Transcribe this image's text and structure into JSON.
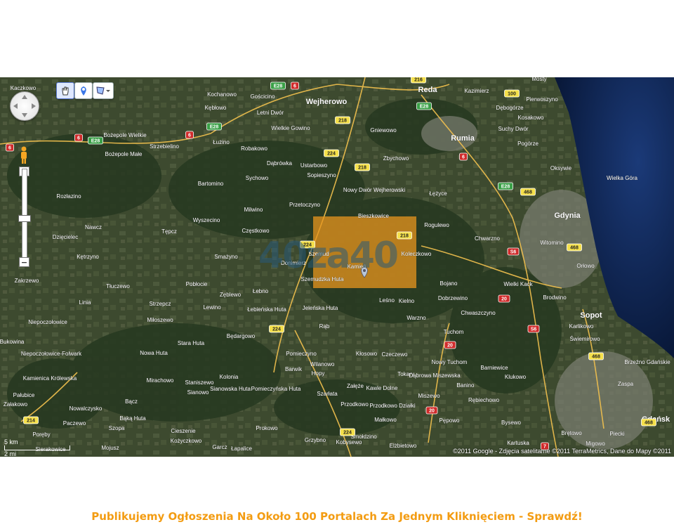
{
  "map": {
    "colors": {
      "forest": "#2e3f24",
      "fields": "#4a5a3a",
      "sea": "#0d1f45",
      "highlight": "#e8951e",
      "road": "#f2c14e"
    },
    "controls": {
      "pan_icon": "pan-circle-icon",
      "hand_tool": "hand-icon",
      "marker_tool": "marker-icon",
      "shape_tool": "polygon-icon",
      "zoom_in": "+",
      "zoom_out": "−"
    },
    "scale": {
      "km": "5 km",
      "mi": "2 mi"
    },
    "copyright": "©2011 Google - Zdjęcia satelitarne ©2011 TerraMetrics, Dane do Mapy ©2011",
    "watermark": "40za40",
    "selected_place": "Kamień",
    "places": [
      {
        "id": "kaczkowo",
        "name": "Kaczkowo"
      },
      {
        "id": "kochanowo",
        "name": "Kochanowo"
      },
      {
        "id": "goscicino",
        "name": "Gościcino"
      },
      {
        "id": "wejherowo",
        "name": "Wejherowo"
      },
      {
        "id": "reda",
        "name": "Reda"
      },
      {
        "id": "kazimierz",
        "name": "Kazimierz"
      },
      {
        "id": "mosty",
        "name": "Mosty"
      },
      {
        "id": "pierwoszyno",
        "name": "Pierwoszyno"
      },
      {
        "id": "kebiowo",
        "name": "Kębłowo"
      },
      {
        "id": "letnidwor",
        "name": "Letni Dwór"
      },
      {
        "id": "wielkiegowino",
        "name": "Wielkie Gowino"
      },
      {
        "id": "gniewowo",
        "name": "Gniewowo"
      },
      {
        "id": "rumia",
        "name": "Rumia"
      },
      {
        "id": "debogorze",
        "name": "Dębogórze"
      },
      {
        "id": "kosakowo",
        "name": "Kosakowo"
      },
      {
        "id": "suchydwor",
        "name": "Suchy Dwór"
      },
      {
        "id": "bozepolewielkie",
        "name": "Bożepole Wielkie"
      },
      {
        "id": "bozepolemale",
        "name": "Bożepole Małe"
      },
      {
        "id": "strzebielino",
        "name": "Strzebielino"
      },
      {
        "id": "luzino",
        "name": "Łużino"
      },
      {
        "id": "robakowo",
        "name": "Robakowo"
      },
      {
        "id": "zbychowo",
        "name": "Zbychowo"
      },
      {
        "id": "pogorze",
        "name": "Pogórze"
      },
      {
        "id": "oksywie",
        "name": "Oksywie"
      },
      {
        "id": "dabrowka",
        "name": "Dąbrówka"
      },
      {
        "id": "ustarbowo",
        "name": "Ustarbowo"
      },
      {
        "id": "bartomino",
        "name": "Bartomino"
      },
      {
        "id": "sychowo",
        "name": "Sychowo"
      },
      {
        "id": "sopieszyno",
        "name": "Sopieszyno"
      },
      {
        "id": "nowydwor",
        "name": "Nowy Dwór Wejherowski"
      },
      {
        "id": "lezyce",
        "name": "Łężyce"
      },
      {
        "id": "rozlazino",
        "name": "Rozłazino"
      },
      {
        "id": "przetoczyno",
        "name": "Przetoczyno"
      },
      {
        "id": "milwino",
        "name": "Milwino"
      },
      {
        "id": "bieszkowice",
        "name": "Bieszkowice"
      },
      {
        "id": "gdynia",
        "name": "Gdynia"
      },
      {
        "id": "rogulewo",
        "name": "Rogulewo"
      },
      {
        "id": "nawcz",
        "name": "Nawcz"
      },
      {
        "id": "tepcz",
        "name": "Tępcz"
      },
      {
        "id": "wyszecino",
        "name": "Wyszecino"
      },
      {
        "id": "czestkowo",
        "name": "Częstkowo"
      },
      {
        "id": "dzieciele",
        "name": "Dzięcielec"
      },
      {
        "id": "szemud",
        "name": "Szemud"
      },
      {
        "id": "koleczkowo",
        "name": "Koleczkowo"
      },
      {
        "id": "chwarzno",
        "name": "Chwarzno"
      },
      {
        "id": "witomino",
        "name": "Witomino"
      },
      {
        "id": "ketrzyno",
        "name": "Kętrzyno"
      },
      {
        "id": "smazyno",
        "name": "Smażyno"
      },
      {
        "id": "donimierz",
        "name": "Donimierz"
      },
      {
        "id": "kamien",
        "name": "Kamień"
      },
      {
        "id": "orlowo",
        "name": "Orłowo"
      },
      {
        "id": "zakrzewo",
        "name": "Zakrzewo"
      },
      {
        "id": "pobłocie",
        "name": "Pobłocie"
      },
      {
        "id": "szemudzkahuta",
        "name": "Szemudzka Huta"
      },
      {
        "id": "bojano",
        "name": "Bojano"
      },
      {
        "id": "wielkikack",
        "name": "Wielki Kack"
      },
      {
        "id": "tluczewo",
        "name": "Tłuczewo"
      },
      {
        "id": "zeblewo",
        "name": "Zęblewo"
      },
      {
        "id": "lebno",
        "name": "Łebno"
      },
      {
        "id": "brodwino",
        "name": "Brodwino"
      },
      {
        "id": "linia",
        "name": "Linia"
      },
      {
        "id": "strzepcz",
        "name": "Strzepcz"
      },
      {
        "id": "lewino",
        "name": "Lewino"
      },
      {
        "id": "lebienskahuta",
        "name": "Łebieńska Huta"
      },
      {
        "id": "jelenskahuta",
        "name": "Jeleńska Huta"
      },
      {
        "id": "lesno",
        "name": "Leśno"
      },
      {
        "id": "kielno",
        "name": "Kielno"
      },
      {
        "id": "dobrzewino",
        "name": "Dobrzewino"
      },
      {
        "id": "chwaszczyno",
        "name": "Chwaszczyno"
      },
      {
        "id": "sopot",
        "name": "Sopot"
      },
      {
        "id": "niepoczolowice",
        "name": "Niepoczołowice"
      },
      {
        "id": "miloszewo",
        "name": "Miłoszewo"
      },
      {
        "id": "rab",
        "name": "Rąb"
      },
      {
        "id": "warzno",
        "name": "Warzno"
      },
      {
        "id": "karlikowo",
        "name": "Karlikowo"
      },
      {
        "id": "tuchom",
        "name": "Tuchom"
      },
      {
        "id": "bedargowo",
        "name": "Będargowo"
      },
      {
        "id": "swiemirowo",
        "name": "Świemirowo"
      },
      {
        "id": "bukowina",
        "name": "Bukowina"
      },
      {
        "id": "starahuta",
        "name": "Stara Huta"
      },
      {
        "id": "niepoczfolwark",
        "name": "Niepoczołowice-Folwark"
      },
      {
        "id": "nowahuta",
        "name": "Nowa Huta"
      },
      {
        "id": "pomieczyno",
        "name": "Pomieczyno"
      },
      {
        "id": "klosowo",
        "name": "Kłosowo"
      },
      {
        "id": "czeczewo",
        "name": "Czeczewo"
      },
      {
        "id": "nowytuchom",
        "name": "Nowy Tuchom"
      },
      {
        "id": "barniewice",
        "name": "Barniewice"
      },
      {
        "id": "brzeznodanskie",
        "name": "Brzeźno Gdańskie"
      },
      {
        "id": "barwik",
        "name": "Barwik"
      },
      {
        "id": "wilanowo",
        "name": "Wilanowo"
      },
      {
        "id": "tokary",
        "name": "Tokary"
      },
      {
        "id": "kamienicakrolewska",
        "name": "Kamienica Królewska"
      },
      {
        "id": "mirachowo",
        "name": "Mirachowo"
      },
      {
        "id": "kolonia",
        "name": "Kolonia"
      },
      {
        "id": "hopy",
        "name": "Hopy"
      },
      {
        "id": "dabrowamiszewska",
        "name": "Dąbrowa Miszewska"
      },
      {
        "id": "klukowo",
        "name": "Klukowo"
      },
      {
        "id": "staniszewo",
        "name": "Staniszewo"
      },
      {
        "id": "sianowskahuta",
        "name": "Sianowska Huta"
      },
      {
        "id": "pomieczynskahuta",
        "name": "Pomieczyńska Huta"
      },
      {
        "id": "zalaze",
        "name": "Załęże"
      },
      {
        "id": "kawledolne",
        "name": "Kawle Dolne"
      },
      {
        "id": "banino",
        "name": "Banino"
      },
      {
        "id": "zaspa",
        "name": "Zaspa"
      },
      {
        "id": "patubice",
        "name": "Pałubice"
      },
      {
        "id": "sianowo",
        "name": "Sianowo"
      },
      {
        "id": "szarlata",
        "name": "Szarłata"
      },
      {
        "id": "miszewo",
        "name": "Miszewo"
      },
      {
        "id": "rebiechowo",
        "name": "Rębiechowo"
      },
      {
        "id": "zalakowo",
        "name": "Załakowo"
      },
      {
        "id": "bacz",
        "name": "Bącz"
      },
      {
        "id": "nowalczysko",
        "name": "Nowalczysko"
      },
      {
        "id": "przodkowo",
        "name": "Przodkowo"
      },
      {
        "id": "przodkowodzialki",
        "name": "Przodkowo Działki"
      },
      {
        "id": "pepowo",
        "name": "Pępowo"
      },
      {
        "id": "gdansk",
        "name": "Gdańsk"
      },
      {
        "id": "bakahuta",
        "name": "Bąką Huta"
      },
      {
        "id": "paczewo",
        "name": "Paczewo"
      },
      {
        "id": "malkowo",
        "name": "Małkowo"
      },
      {
        "id": "bysewo",
        "name": "Bysewo"
      },
      {
        "id": "szopa",
        "name": "Szopa"
      },
      {
        "id": "ciesznie",
        "name": "Cieszenie"
      },
      {
        "id": "prokowo",
        "name": "Prokowo"
      },
      {
        "id": "smolnik",
        "name": "Smołdzino"
      },
      {
        "id": "poreby",
        "name": "Poręby"
      },
      {
        "id": "brętowo",
        "name": "Brętowo"
      },
      {
        "id": "piecki",
        "name": "Piecki"
      },
      {
        "id": "kozyczkowo",
        "name": "Kożyczkowo"
      },
      {
        "id": "grzybno",
        "name": "Grzybno"
      },
      {
        "id": "kobysewo",
        "name": "Kobysewo"
      },
      {
        "id": "elzbietowo",
        "name": "Elżbietowo"
      },
      {
        "id": "migowo",
        "name": "Migowo"
      },
      {
        "id": "siemirowice",
        "name": "Sierakowice"
      },
      {
        "id": "mojusz",
        "name": "Mojusz"
      },
      {
        "id": "garcz",
        "name": "Garcz"
      },
      {
        "id": "lapalice",
        "name": "Łapalice"
      },
      {
        "id": "kartuska",
        "name": "Kartuska"
      },
      {
        "id": "wielkagora",
        "name": "Wielka Góra"
      }
    ],
    "roads": [
      {
        "id": "r6a",
        "label": "6"
      },
      {
        "id": "r6b",
        "label": "6"
      },
      {
        "id": "r6c",
        "label": "6"
      },
      {
        "id": "r6d",
        "label": "6"
      },
      {
        "id": "r6e",
        "label": "6"
      },
      {
        "id": "e28a",
        "label": "E28"
      },
      {
        "id": "e28b",
        "label": "E28"
      },
      {
        "id": "e28c",
        "label": "E28"
      },
      {
        "id": "e28d",
        "label": "E28"
      },
      {
        "id": "e28e",
        "label": "E28"
      },
      {
        "id": "r216",
        "label": "216"
      },
      {
        "id": "r218a",
        "label": "218"
      },
      {
        "id": "r218b",
        "label": "218"
      },
      {
        "id": "r218c",
        "label": "218"
      },
      {
        "id": "r224a",
        "label": "224"
      },
      {
        "id": "r224b",
        "label": "224"
      },
      {
        "id": "r224c",
        "label": "224"
      },
      {
        "id": "r224d",
        "label": "224"
      },
      {
        "id": "r100",
        "label": "100"
      },
      {
        "id": "r468a",
        "label": "468"
      },
      {
        "id": "r468b",
        "label": "468"
      },
      {
        "id": "r468c",
        "label": "468"
      },
      {
        "id": "r468d",
        "label": "468"
      },
      {
        "id": "s6a",
        "label": "S6"
      },
      {
        "id": "s6b",
        "label": "S6"
      },
      {
        "id": "r20a",
        "label": "20"
      },
      {
        "id": "r20b",
        "label": "20"
      },
      {
        "id": "r20c",
        "label": "20"
      },
      {
        "id": "r214",
        "label": "214"
      },
      {
        "id": "r7",
        "label": "7"
      }
    ]
  },
  "promo": {
    "text": "Publikujemy Ogłoszenia Na Około 100 Portalach Za Jednym Kliknięciem - Sprawdź!"
  }
}
